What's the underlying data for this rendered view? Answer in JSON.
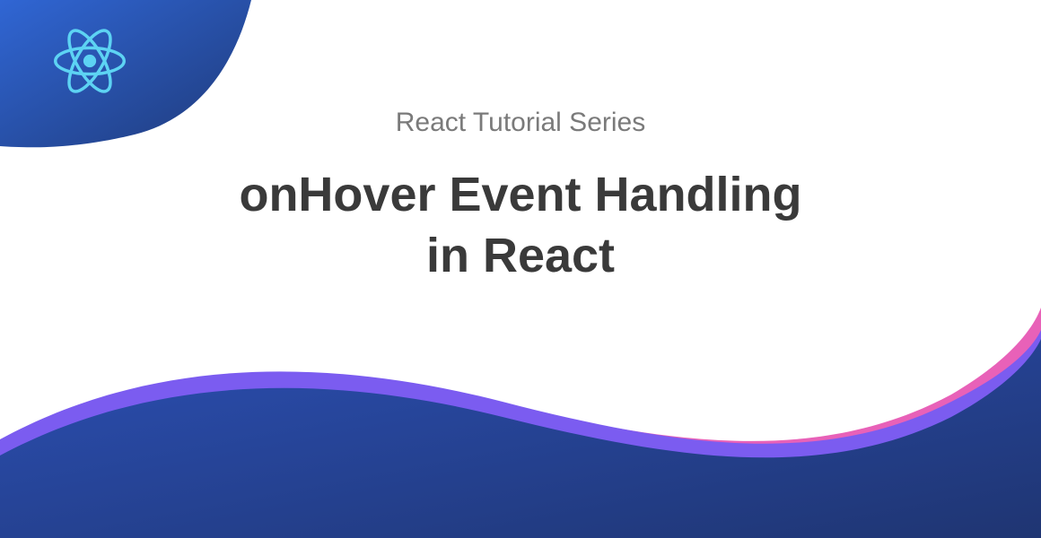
{
  "subtitle": "React Tutorial Series",
  "title_line1": "onHover Event Handling",
  "title_line2": "in React",
  "colors": {
    "background": "#ffffff",
    "subtitle": "#7a7a7a",
    "title": "#3a3a3a",
    "dark_blue": "#1f3e8a",
    "blue_gradient_start": "#2c5dc9",
    "blue_gradient_end": "#1f3a7a",
    "purple": "#7b5cf0",
    "pink": "#e861b8",
    "react_cyan": "#5dd3f3"
  }
}
